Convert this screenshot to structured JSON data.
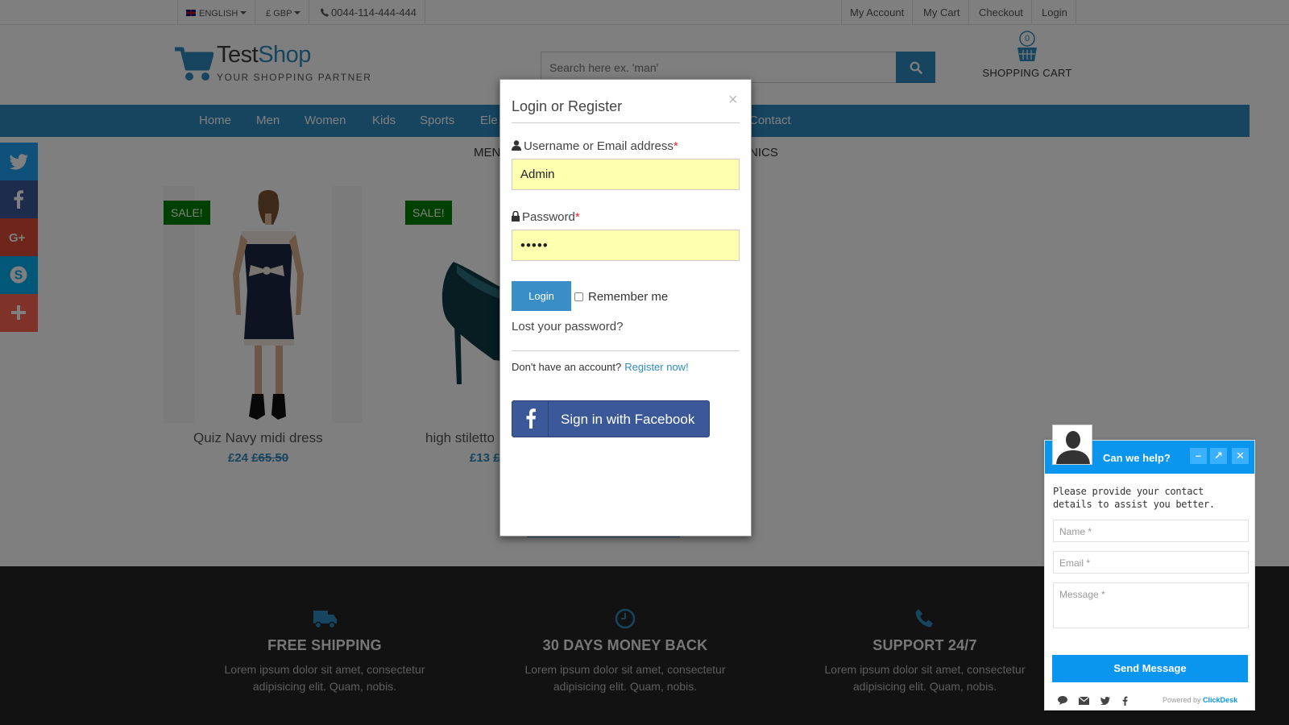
{
  "topbar": {
    "language": "ENGLISH",
    "currency": "£ GBP",
    "phone": "0044-114-444-444",
    "links": [
      "My Account",
      "My Cart",
      "Checkout",
      "Login"
    ]
  },
  "header": {
    "brand_part1": "Test",
    "brand_part2": "Shop",
    "tagline": "YOUR SHOPPING PARTNER",
    "search_placeholder": "Search here ex. 'man'",
    "cart_count": "0",
    "cart_label": "SHOPPING CART"
  },
  "nav": {
    "items": [
      "Home",
      "Men",
      "Women",
      "Kids",
      "Sports",
      "Ele",
      "Contact"
    ]
  },
  "categories": {
    "left": "MEN",
    "right": "NICS"
  },
  "products": [
    {
      "badge": "SALE!",
      "name": "Quiz Navy midi dress",
      "price": "£24",
      "old_price": "£65.50"
    },
    {
      "badge": "SALE!",
      "name": "high stiletto",
      "price": "£13",
      "old_price": "£"
    }
  ],
  "features": [
    {
      "icon": "truck-icon",
      "title": "FREE SHIPPING",
      "desc": "Lorem ipsum dolor sit amet, consectetur adipisicing elit. Quam, nobis."
    },
    {
      "icon": "clock-icon",
      "title": "30 DAYS MONEY BACK",
      "desc": "Lorem ipsum dolor sit amet, consectetur adipisicing elit. Quam, nobis."
    },
    {
      "icon": "phone-icon",
      "title": "SUPPORT 24/7",
      "desc": "Lorem ipsum dolor sit amet, consectetur adipisicing elit. Quam, nobis."
    }
  ],
  "modal": {
    "title": "Login or Register",
    "close": "×",
    "username_label": "Username or Email address",
    "username_value": "Admin",
    "password_label": "Password",
    "password_value": "•••••",
    "required_mark": "*",
    "login_button": "Login",
    "remember_me": "Remember me",
    "lost_password": "Lost your password?",
    "no_account": "Don't have an account?",
    "register_link": "Register now!",
    "facebook_button": "Sign in with Facebook"
  },
  "chat": {
    "title": "Can we help?",
    "intro": "Please provide your contact details to assist you better.",
    "name_placeholder": "Name *",
    "email_placeholder": "Email *",
    "message_placeholder": "Message *",
    "send_button": "Send Message",
    "powered_by": "Powered by",
    "powered_brand": "ClickDesk",
    "minimize": "–",
    "popout": "↗",
    "close": "✕"
  },
  "colors": {
    "accent": "#2e8bc0",
    "sale_badge": "#008000",
    "facebook": "#3b5998",
    "chat_blue": "#0a95ee",
    "twitter": "#1da1f2",
    "google_plus": "#dd4b39",
    "skype": "#00aff0",
    "share_plus": "#ff6550"
  }
}
